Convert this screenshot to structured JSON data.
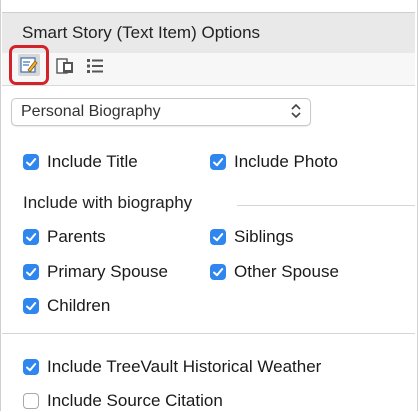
{
  "panel": {
    "title": "Smart Story (Text Item) Options"
  },
  "toolbar": {
    "tools": [
      {
        "icon": "edit-text-icon",
        "selected": true
      },
      {
        "icon": "document-image-icon",
        "selected": false
      },
      {
        "icon": "list-icon",
        "selected": false
      }
    ]
  },
  "story_type": {
    "selected": "Personal Biography"
  },
  "options": {
    "include_title": {
      "label": "Include Title",
      "checked": true
    },
    "include_photo": {
      "label": "Include Photo",
      "checked": true
    }
  },
  "biography": {
    "heading": "Include with biography",
    "parents": {
      "label": "Parents",
      "checked": true
    },
    "siblings": {
      "label": "Siblings",
      "checked": true
    },
    "primary_spouse": {
      "label": "Primary Spouse",
      "checked": true
    },
    "other_spouse": {
      "label": "Other Spouse",
      "checked": true
    },
    "children": {
      "label": "Children",
      "checked": true
    }
  },
  "extras": {
    "weather": {
      "label": "Include TreeVault Historical Weather",
      "checked": true
    },
    "source_citation": {
      "label": "Include Source Citation",
      "checked": false
    }
  },
  "colors": {
    "checkbox_on": "#2f86ee",
    "highlight": "#d2232a"
  }
}
